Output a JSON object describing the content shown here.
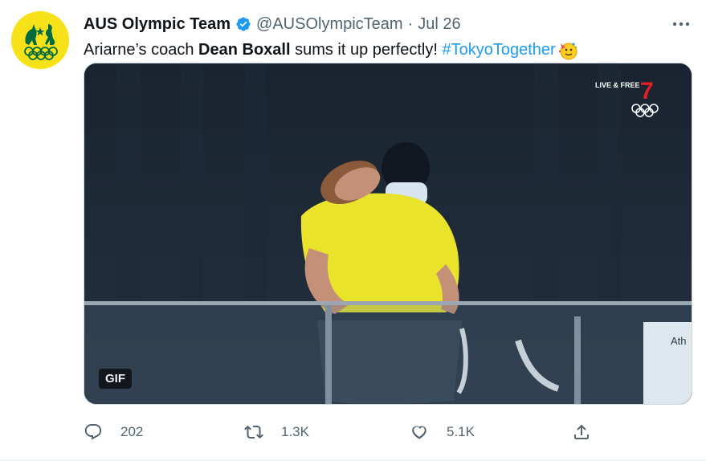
{
  "account": {
    "display_name": "AUS Olympic Team",
    "handle": "@AUSOlympicTeam",
    "separator": "·",
    "date": "Jul 26",
    "verified": true
  },
  "tweet": {
    "text_prefix": "Ariarne’s coach ",
    "text_bold": "Dean Boxall",
    "text_suffix": " sums it up perfectly! ",
    "hashtag": "#TokyoTogether",
    "emoji": "face-with-party-horn"
  },
  "media": {
    "type": "GIF",
    "gif_badge": "GIF",
    "broadcaster_badge": "LIVE & FREE",
    "broadcaster_number": "7",
    "partial_sign_text": "Ath"
  },
  "actions": {
    "replies": "202",
    "retweets": "1.3K",
    "likes": "5.1K"
  },
  "colors": {
    "accent": "#1d9bf0",
    "text": "#0f1419",
    "muted": "#536471",
    "avatar_bg": "#f7e21a",
    "brand_green": "#006b3f"
  },
  "icons": {
    "more": "more-dots-icon",
    "reply": "reply-icon",
    "retweet": "retweet-icon",
    "like": "heart-icon",
    "share": "share-icon"
  }
}
